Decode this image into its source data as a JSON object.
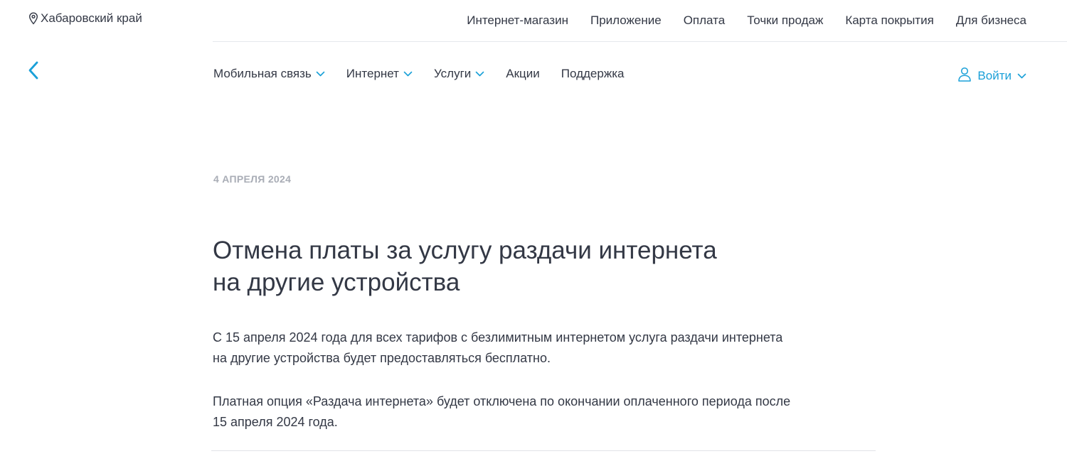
{
  "region": {
    "icon": "location-pin-icon",
    "label": "Хабаровский край"
  },
  "top_links": [
    "Интернет-магазин",
    "Приложение",
    "Оплата",
    "Точки продаж",
    "Карта покрытия",
    "Для бизнеса"
  ],
  "nav": {
    "back_icon": "chevron-left-icon",
    "items": [
      {
        "label": "Мобильная связь",
        "has_dropdown": true
      },
      {
        "label": "Интернет",
        "has_dropdown": true
      },
      {
        "label": "Услуги",
        "has_dropdown": true
      },
      {
        "label": "Акции",
        "has_dropdown": false
      },
      {
        "label": "Поддержка",
        "has_dropdown": false
      }
    ],
    "login": {
      "label": "Войти",
      "icon": "user-icon",
      "has_dropdown": true
    }
  },
  "article": {
    "date": "4 АПРЕЛЯ 2024",
    "title_line1": "Отмена платы за услугу раздачи интернета",
    "title_line2": "на другие устройства",
    "paragraphs": [
      {
        "line1": "С 15 апреля 2024 года для всех тарифов с безлимитным интернетом услуга раздачи интернета",
        "line2": "на другие устройства будет предоставляться бесплатно."
      },
      {
        "line1": "Платная опция «Раздача интернета» будет отключена по окончании оплаченного периода после",
        "line2": "15 апреля 2024 года."
      }
    ]
  },
  "colors": {
    "accent": "#1aa0d8",
    "text": "#333845",
    "muted": "#a9adb6",
    "divider": "#e6e8ec"
  }
}
